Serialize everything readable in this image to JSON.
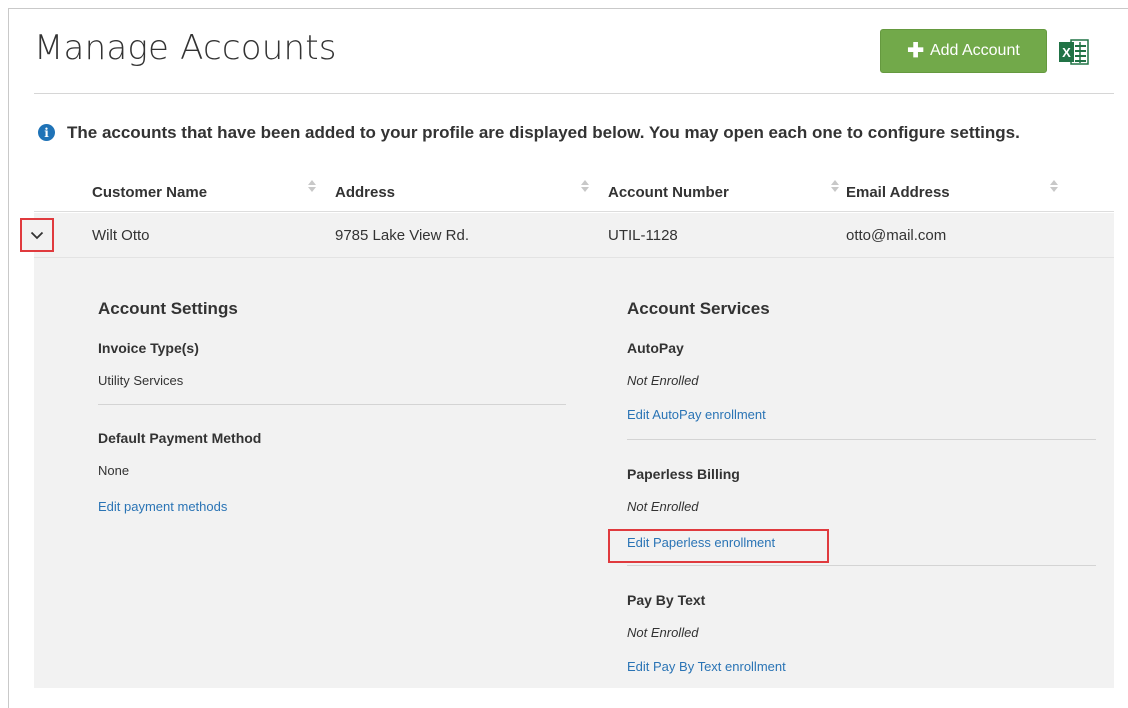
{
  "page": {
    "title": "Manage Accounts"
  },
  "toolbar": {
    "add_account_label": "Add Account",
    "add_icon": "plus-icon",
    "export_icon": "excel-export-icon"
  },
  "info": {
    "icon": "info-circle-icon",
    "text": "The accounts that have been added to your profile are displayed below. You may open each one to configure settings."
  },
  "table": {
    "columns": [
      "Customer Name",
      "Address",
      "Account Number",
      "Email Address"
    ],
    "rows": [
      {
        "customer_name": "Wilt Otto",
        "address": "9785 Lake View Rd.",
        "account_number": "UTIL-1128",
        "email": "otto@mail.com"
      }
    ]
  },
  "account_settings": {
    "title": "Account Settings",
    "invoice_types_label": "Invoice Type(s)",
    "invoice_types_value": "Utility Services",
    "default_payment_label": "Default Payment Method",
    "default_payment_value": "None",
    "edit_payment_link": "Edit payment methods"
  },
  "account_services": {
    "title": "Account Services",
    "autopay": {
      "label": "AutoPay",
      "status": "Not Enrolled",
      "link": "Edit AutoPay enrollment"
    },
    "paperless": {
      "label": "Paperless Billing",
      "status": "Not Enrolled",
      "link": "Edit Paperless enrollment"
    },
    "pay_by_text": {
      "label": "Pay By Text",
      "status": "Not Enrolled",
      "link": "Edit Pay By Text enrollment"
    }
  },
  "colors": {
    "accent_green": "#72a94a",
    "link_blue": "#2a74b5",
    "highlight_red": "#e03a3e",
    "info_blue": "#1f73b7"
  }
}
